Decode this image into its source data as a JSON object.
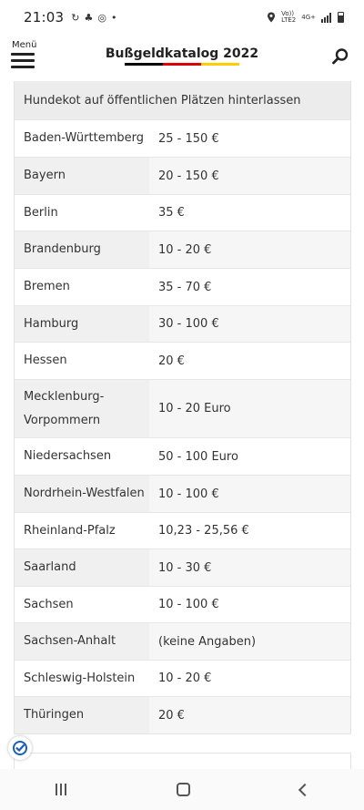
{
  "status_bar": {
    "time": "21:03",
    "network_line1": "Vo))",
    "network_line2": "LTE2",
    "network_type": "4G+"
  },
  "header": {
    "menu_label": "Menü",
    "title": "Bußgeldkatalog 2022",
    "flag_colors": [
      "#000000",
      "#dd0000",
      "#ffce00"
    ]
  },
  "table": {
    "heading": "Hundekot auf öffentlichen Plätzen hinterlassen",
    "rows": [
      {
        "state": "Baden-Württemberg",
        "fine": "25 - 150 €"
      },
      {
        "state": "Bayern",
        "fine": "20 - 150 €"
      },
      {
        "state": "Berlin",
        "fine": "35 €"
      },
      {
        "state": "Brandenburg",
        "fine": "10 - 20 €"
      },
      {
        "state": "Bremen",
        "fine": "35 - 70 €"
      },
      {
        "state": "Hamburg",
        "fine": "30 - 100 €"
      },
      {
        "state": "Hessen",
        "fine": "20 €"
      },
      {
        "state": "Mecklenburg-\nVorpommern",
        "fine": "10 - 20 Euro"
      },
      {
        "state": "Niedersachsen",
        "fine": "50 - 100 Euro"
      },
      {
        "state": "Nordrhein-Westfalen",
        "fine": "10 - 100 €"
      },
      {
        "state": "Rheinland-Pfalz",
        "fine": "10,23 - 25,56 €"
      },
      {
        "state": "Saarland",
        "fine": "10 - 30 €"
      },
      {
        "state": "Sachsen",
        "fine": "10 - 100 €"
      },
      {
        "state": "Sachsen-Anhalt",
        "fine": "(keine Angaben)"
      },
      {
        "state": "Schleswig-Holstein",
        "fine": "10 - 20 €"
      },
      {
        "state": "Thüringen",
        "fine": "20 €"
      }
    ]
  }
}
